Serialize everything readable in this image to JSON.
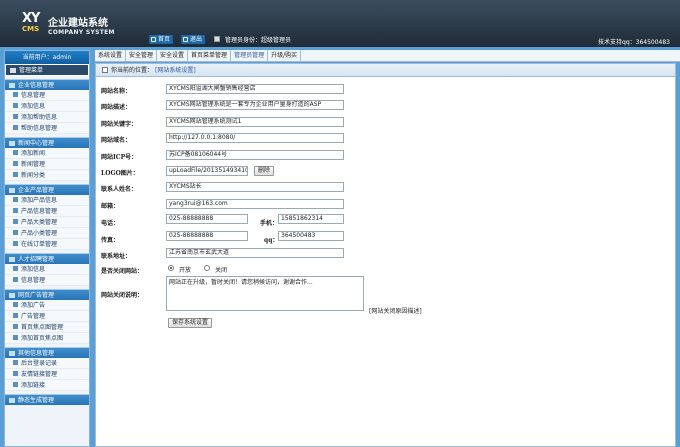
{
  "header": {
    "logo_xy": "XY",
    "logo_cms": "CMS",
    "title": "企业建站系统",
    "subtitle": "COMPANY SYSTEM",
    "home_label": "首页",
    "logout_label": "退出",
    "admin_identity": "管理员身份：超级管理员",
    "support": "技术支持qq：364500483"
  },
  "sidebar": {
    "user_label": "当前用户：admin",
    "root_label": "管理菜单",
    "groups": [
      {
        "title": "企业信息管理",
        "items": [
          "信息管理",
          "添加信息",
          "添加帮助信息",
          "帮助信息管理"
        ]
      },
      {
        "title": "新闻中心管理",
        "items": [
          "添加新闻",
          "新闻管理",
          "新闻分类"
        ]
      },
      {
        "title": "企业产品管理",
        "items": [
          "添加产品信息",
          "产品信息管理",
          "产品大类管理",
          "产品小类管理",
          "在线订单管理"
        ]
      },
      {
        "title": "人才招聘管理",
        "items": [
          "添加信息",
          "信息管理"
        ]
      },
      {
        "title": "网页广告管理",
        "items": [
          "添加广告",
          "广告管理",
          "首页焦点图管理",
          "添加首页焦点图"
        ]
      },
      {
        "title": "其他信息管理",
        "items": [
          "后台登录记录",
          "友情链接管理",
          "添加链接"
        ]
      },
      {
        "title": "静态生成管理",
        "items": []
      }
    ]
  },
  "tabs": [
    "系统设置",
    "安全管理",
    "安全设置",
    "首页菜单管理",
    "管理员管理",
    "升级/购买"
  ],
  "breadcrumb": {
    "prefix": "你当前的位置：",
    "current": "[网站系统设置]"
  },
  "form": {
    "site_name_label": "网站名称：",
    "site_name": "XYCMS阳溢湖大闸蟹销售经营店",
    "site_desc_label": "网站描述：",
    "site_desc": "XYCMS网站管理系统是一套专为企业用户量身打造的ASP",
    "keywords_label": "网站关键字：",
    "keywords": "XYCMS网站管理系统测试1",
    "domain_label": "网站域名：",
    "domain": "http://127.0.0.1:8080/",
    "icp_label": "网站ICP号：",
    "icp": "苏ICP备08106044号",
    "logo_label": "LOGO图片：",
    "logo_path": "upLoadFile/20135149341022",
    "delete_label": "删除",
    "contact_label": "联系人姓名：",
    "contact": "XYCMS站长",
    "email_label": "邮箱：",
    "email": "yang3rui@163.com",
    "phone_label": "电话：",
    "phone": "025-88888888",
    "mobile_label": "手机：",
    "mobile": "15851862314",
    "fax_label": "传真：",
    "fax": "025-88888888",
    "qq_label": "qq：",
    "qq": "364500483",
    "address_label": "联系地址：",
    "address": "江苏省南京市玄武大道",
    "close_site_label": "是否关闭网站：",
    "open_option": "开放",
    "close_option": "关闭",
    "close_reason_label": "网站关闭说明：",
    "close_reason": "网站正在升级，暂时关闭！请您稍候访问，谢谢合作...",
    "close_note": "[网站关闭原因描述]",
    "save_label": "保存系统设置"
  }
}
